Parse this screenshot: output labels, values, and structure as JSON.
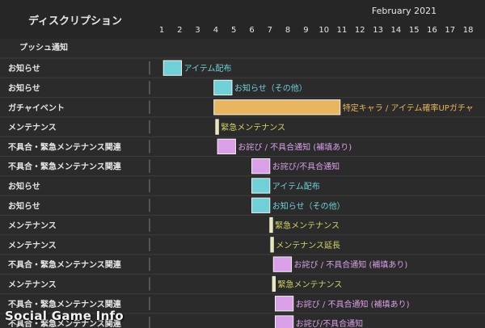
{
  "chart_data": {
    "type": "gantt",
    "title": "February 2021",
    "column_header": "ディスクリプション",
    "section_label": "プッシュ通知",
    "days": [
      1,
      2,
      3,
      4,
      5,
      6,
      7,
      8,
      9,
      10,
      11,
      12,
      13,
      14,
      15,
      16,
      17,
      18
    ],
    "rows": [
      {
        "category": "お知らせ",
        "label": "アイテム配布",
        "start": 1.1,
        "end": 2.1,
        "color": "#6fd0d8",
        "label_color": "#6fd0d8"
      },
      {
        "category": "お知らせ",
        "label": "お知らせ（その他）",
        "start": 3.9,
        "end": 4.9,
        "color": "#6fd0d8",
        "label_color": "#6fd0d8"
      },
      {
        "category": "ガチャイベント",
        "label": "特定キャラ / アイテム確率UPガチャ",
        "start": 3.9,
        "end": 10.9,
        "color": "#e8b560",
        "label_color": "#e8b560"
      },
      {
        "category": "メンテナンス",
        "label": "緊急メンテナンス",
        "start": 4.0,
        "end": 4.15,
        "color": "#e8e8a0",
        "label_color": "#d4d46a"
      },
      {
        "category": "不具合・緊急メンテナンス関連",
        "label": "お詫び / 不具合通知 (補填あり)",
        "start": 4.1,
        "end": 5.1,
        "color": "#d9a0e8",
        "label_color": "#d9a0e8"
      },
      {
        "category": "不具合・緊急メンテナンス関連",
        "label": "お詫び/不具合通知",
        "start": 6.0,
        "end": 7.0,
        "color": "#d9a0e8",
        "label_color": "#d9a0e8"
      },
      {
        "category": "お知らせ",
        "label": "アイテム配布",
        "start": 6.0,
        "end": 7.0,
        "color": "#6fd0d8",
        "label_color": "#6fd0d8"
      },
      {
        "category": "お知らせ",
        "label": "お知らせ（その他）",
        "start": 6.0,
        "end": 7.0,
        "color": "#6fd0d8",
        "label_color": "#6fd0d8"
      },
      {
        "category": "メンテナンス",
        "label": "緊急メンテナンス",
        "start": 7.0,
        "end": 7.15,
        "color": "#e8e8a0",
        "label_color": "#d4d46a"
      },
      {
        "category": "メンテナンス",
        "label": "メンテナンス延長",
        "start": 7.05,
        "end": 7.2,
        "color": "#e8e8a0",
        "label_color": "#d4d46a"
      },
      {
        "category": "不具合・緊急メンテナンス関連",
        "label": "お詫び / 不具合通知 (補填あり)",
        "start": 7.2,
        "end": 8.2,
        "color": "#d9a0e8",
        "label_color": "#d9a0e8"
      },
      {
        "category": "メンテナンス",
        "label": "緊急メンテナンス",
        "start": 7.15,
        "end": 7.3,
        "color": "#e8e8a0",
        "label_color": "#d4d46a"
      },
      {
        "category": "不具合・緊急メンテナンス関連",
        "label": "お詫び / 不具合通知 (補填あり)",
        "start": 7.3,
        "end": 8.3,
        "color": "#d9a0e8",
        "label_color": "#d9a0e8"
      },
      {
        "category": "不具合・緊急メンテナンス関連",
        "label": "お詫び/不具合通知",
        "start": 7.3,
        "end": 8.3,
        "color": "#d9a0e8",
        "label_color": "#d9a0e8"
      }
    ]
  },
  "watermark": "Social Game Info"
}
